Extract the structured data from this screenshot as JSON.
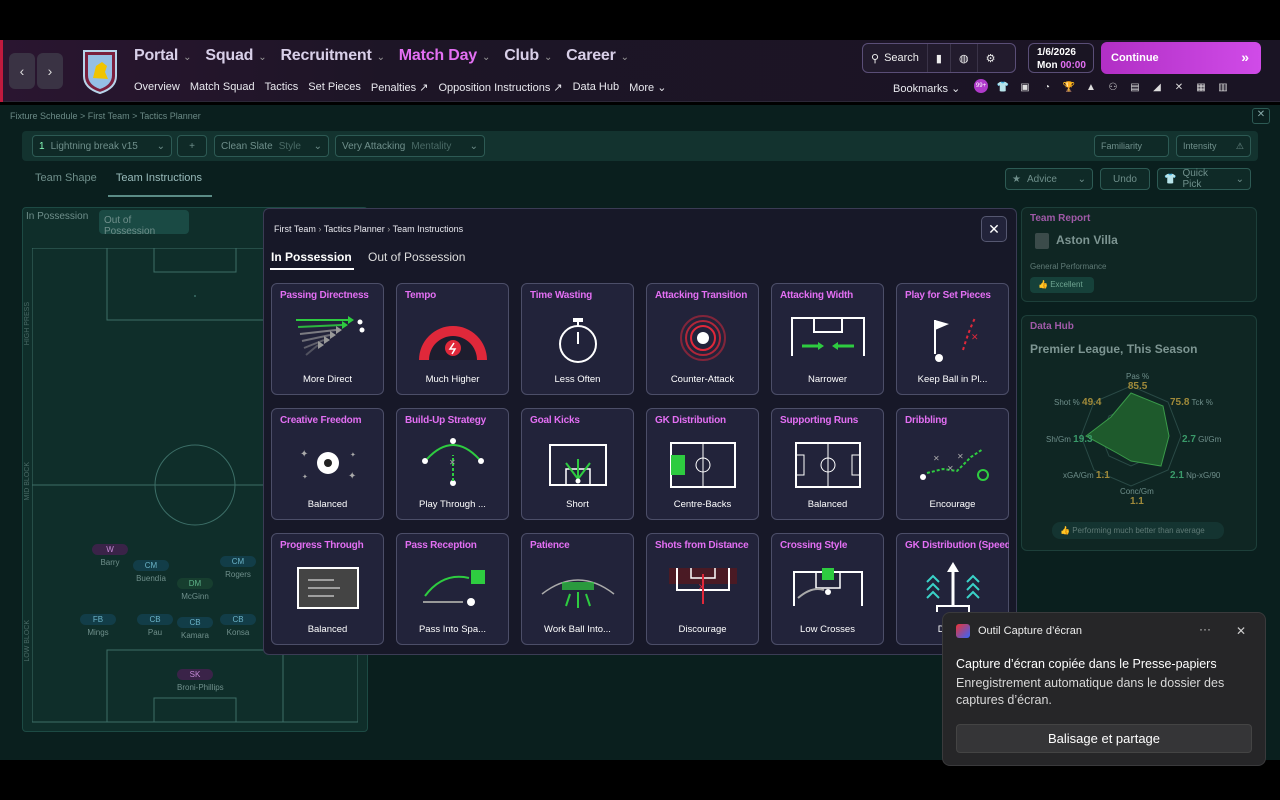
{
  "header": {
    "nav": [
      {
        "label": "Portal",
        "active": false
      },
      {
        "label": "Squad",
        "active": false
      },
      {
        "label": "Recruitment",
        "active": false
      },
      {
        "label": "Match Day",
        "active": true
      },
      {
        "label": "Club",
        "active": false
      },
      {
        "label": "Career",
        "active": false
      }
    ],
    "subnav": [
      "Overview",
      "Match Squad",
      "Tactics",
      "Set Pieces",
      "Penalties",
      "Opposition Instructions",
      "Data Hub",
      "More"
    ],
    "search_label": "Search",
    "date": "1/6/2026",
    "day": "Mon",
    "time": "00:00",
    "continue_label": "Continue",
    "bookmarks_label": "Bookmarks",
    "badge_one": "99+"
  },
  "background": {
    "breadcrumb": "Fixture Schedule  >  First Team  >  Tactics Planner",
    "tactic_name": "Lightning break v15",
    "tactic_num": "1",
    "style_value": "Clean Slate",
    "style_label": "Style",
    "mentality_value": "Very Attacking",
    "mentality_label": "Mentality",
    "familiarity": "Familiarity",
    "intensity": "Intensity",
    "tabs": [
      "Team Shape",
      "Team Instructions"
    ],
    "advice": "Advice",
    "undo": "Undo",
    "quick_pick": "Quick Pick",
    "phase_tabs": [
      "In Possession",
      "Out of Possession"
    ],
    "side_labels": [
      "HIGH PRESS",
      "MID BLOCK",
      "LOW BLOCK"
    ],
    "players": [
      {
        "pos": "W",
        "name": "Barry",
        "pill": "w"
      },
      {
        "pos": "CM",
        "name": "Buendía",
        "pill": "b"
      },
      {
        "pos": "CM",
        "name": "Rogers",
        "pill": "b"
      },
      {
        "pos": "DM",
        "name": "McGinn",
        "pill": "g"
      },
      {
        "pos": "FB",
        "name": "Mings",
        "pill": "b"
      },
      {
        "pos": "CB",
        "name": "Pau",
        "pill": "b"
      },
      {
        "pos": "CB",
        "name": "Kamara",
        "pill": "b"
      },
      {
        "pos": "CB",
        "name": "Konsa",
        "pill": "b"
      },
      {
        "pos": "SK",
        "name": "Broni-Phillips",
        "pill": "w"
      }
    ],
    "team_report": {
      "title": "Team Report",
      "team": "Aston Villa",
      "perf_label": "General Performance",
      "perf_value": "Excellent"
    },
    "data_hub": {
      "title": "Data Hub",
      "subtitle": "Premier League, This Season",
      "stats": [
        {
          "label": "Pas %",
          "value": "85.5"
        },
        {
          "label": "Tck %",
          "value": "75.8"
        },
        {
          "label": "Gl/Gm",
          "value": "2.7"
        },
        {
          "label": "Np-xG/90",
          "value": "2.1"
        },
        {
          "label": "Conc/Gm",
          "value": "1.1"
        },
        {
          "label": "xGA/Gm",
          "value": "1.1"
        },
        {
          "label": "Sh/Gm",
          "value": "19.3"
        },
        {
          "label": "Shot %",
          "value": "49.4"
        }
      ],
      "footer": "Performing much better than average"
    }
  },
  "modal": {
    "breadcrumb": [
      "First Team",
      "Tactics Planner",
      "Team Instructions"
    ],
    "tabs": [
      {
        "label": "In Possession",
        "active": true
      },
      {
        "label": "Out of Possession",
        "active": false
      }
    ],
    "cards": [
      {
        "title": "Passing Directness",
        "value": "More Direct",
        "icon": "passing-arrows-icon"
      },
      {
        "title": "Tempo",
        "value": "Much Higher",
        "icon": "tempo-gauge-icon"
      },
      {
        "title": "Time Wasting",
        "value": "Less Often",
        "icon": "stopwatch-icon"
      },
      {
        "title": "Attacking Transition",
        "value": "Counter-Attack",
        "icon": "target-rings-icon"
      },
      {
        "title": "Attacking Width",
        "value": "Narrower",
        "icon": "narrow-width-icon"
      },
      {
        "title": "Play for Set Pieces",
        "value": "Keep Ball in Pl...",
        "icon": "corner-flag-icon"
      },
      {
        "title": "Creative Freedom",
        "value": "Balanced",
        "icon": "football-sparkle-icon"
      },
      {
        "title": "Build-Up Strategy",
        "value": "Play Through ...",
        "icon": "buildup-icon"
      },
      {
        "title": "Goal Kicks",
        "value": "Short",
        "icon": "goal-kick-icon"
      },
      {
        "title": "GK Distribution",
        "value": "Centre-Backs",
        "icon": "gk-distribution-icon"
      },
      {
        "title": "Supporting Runs",
        "value": "Balanced",
        "icon": "pitch-icon"
      },
      {
        "title": "Dribbling",
        "value": "Encourage",
        "icon": "dribble-icon"
      },
      {
        "title": "Progress Through",
        "value": "Balanced",
        "icon": "progress-pitch-icon"
      },
      {
        "title": "Pass Reception",
        "value": "Pass Into Spa...",
        "icon": "pass-reception-icon"
      },
      {
        "title": "Patience",
        "value": "Work Ball Into...",
        "icon": "patience-icon"
      },
      {
        "title": "Shots from Distance",
        "value": "Discourage",
        "icon": "shots-distance-icon"
      },
      {
        "title": "Crossing Style",
        "value": "Low Crosses",
        "icon": "crossing-icon"
      },
      {
        "title": "GK Distribution (Speed)",
        "value": "Distri...",
        "icon": "gk-speed-icon"
      }
    ]
  },
  "toast": {
    "app": "Outil Capture d’écran",
    "title": "Capture d’écran copiée dans le Presse-papiers",
    "body": "Enregistrement automatique dans le dossier des captures d’écran.",
    "button": "Balisage et partage"
  },
  "colors": {
    "accent": "#e36ff3",
    "green": "#2ecc40",
    "red": "#e0283a",
    "cyan": "#3ad2c8"
  }
}
